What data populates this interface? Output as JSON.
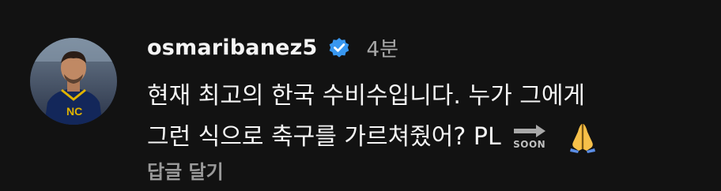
{
  "comment": {
    "username": "osmaribanez5",
    "time": "4분",
    "text_line1": "현재 최고의 한국 수비수입니다. 누가 그에게",
    "text_line2": "그런 식으로 축구를 가르쳐줬어? PL",
    "soon_label": "SOON",
    "reply_label": "답글 달기"
  },
  "icons": {
    "verified": "verified-badge-icon",
    "soon_arrow": "soon-arrow-icon",
    "pray": "folded-hands-icon"
  },
  "colors": {
    "background": "#121212",
    "text": "#f5f5f5",
    "muted": "#a8a8a8",
    "verified_blue": "#3897f0"
  }
}
